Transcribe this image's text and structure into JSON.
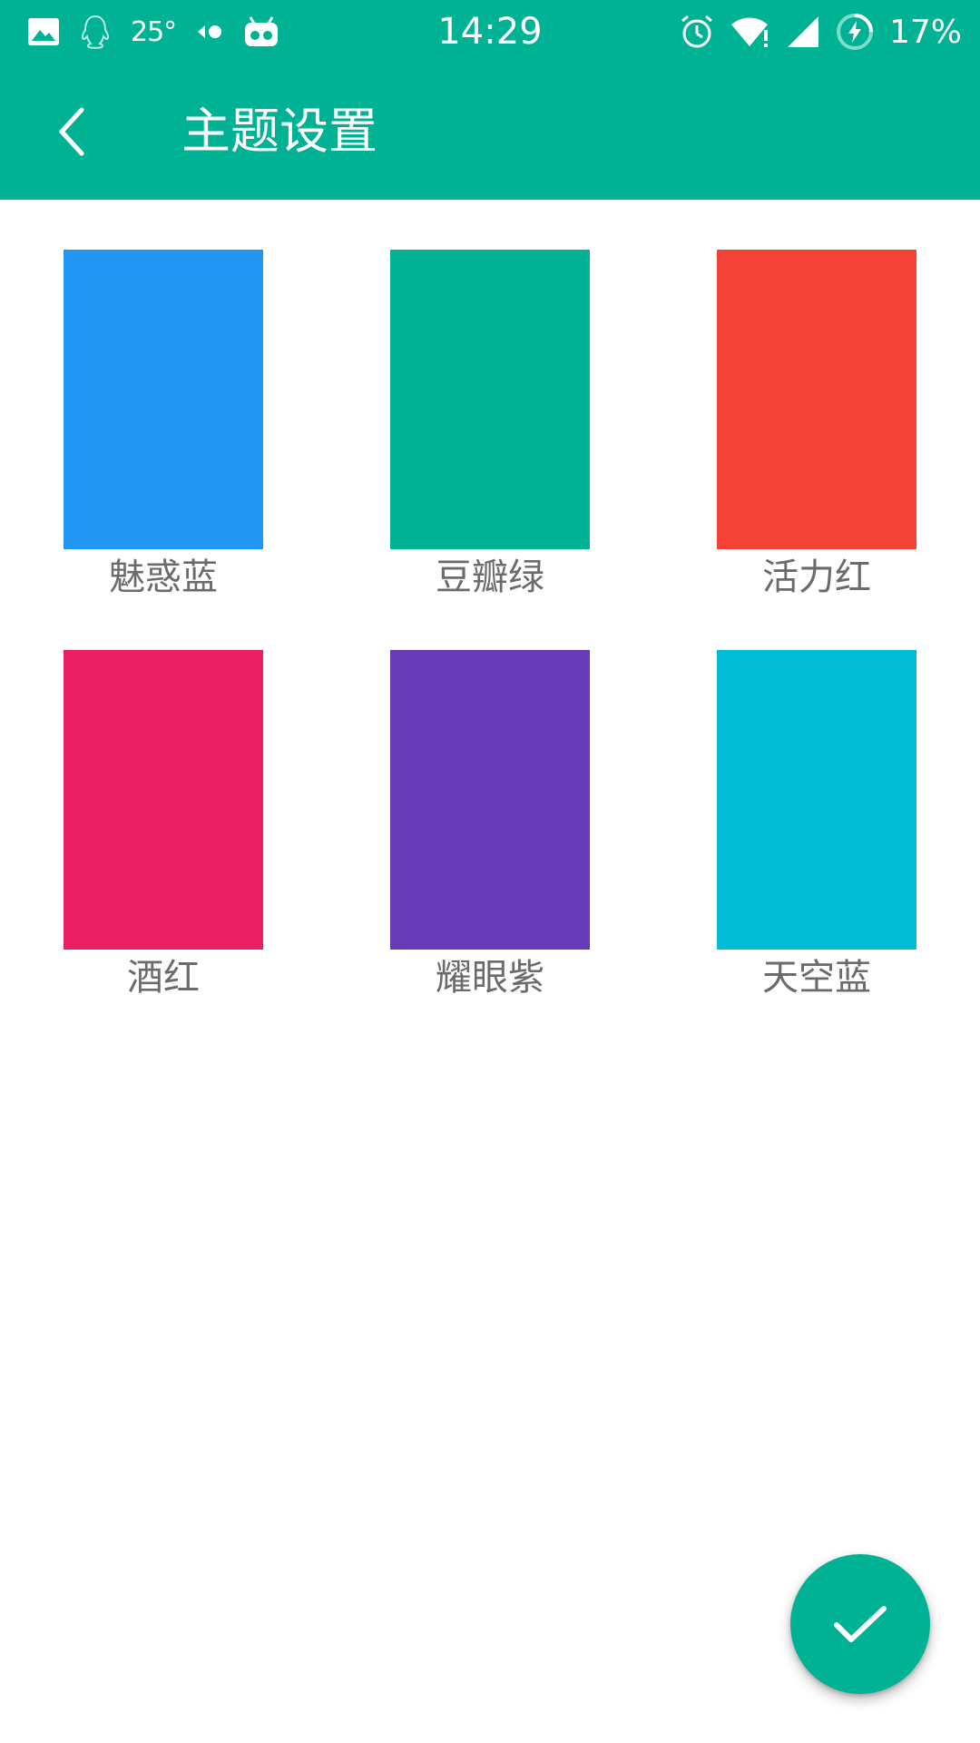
{
  "status_bar": {
    "temperature": "25°",
    "time": "14:29",
    "battery": "17%",
    "icons_left": [
      "image-icon",
      "qq-icon",
      "temperature-text",
      "transfer-icon",
      "robot-icon"
    ],
    "icons_right": [
      "alarm-icon",
      "wifi-icon",
      "signal-icon",
      "battery-charging-icon"
    ]
  },
  "toolbar": {
    "title": "主题设置",
    "back_icon": "back-arrow-icon",
    "background_color": "#00b294"
  },
  "themes": [
    {
      "label": "魅惑蓝",
      "color": "#2196f3"
    },
    {
      "label": "豆瓣绿",
      "color": "#00b294"
    },
    {
      "label": "活力红",
      "color": "#f44336"
    },
    {
      "label": "酒红",
      "color": "#e91e63"
    },
    {
      "label": "耀眼紫",
      "color": "#673ab7"
    },
    {
      "label": "天空蓝",
      "color": "#00bcd4"
    }
  ],
  "fab": {
    "icon": "check-icon",
    "color": "#00b294"
  }
}
